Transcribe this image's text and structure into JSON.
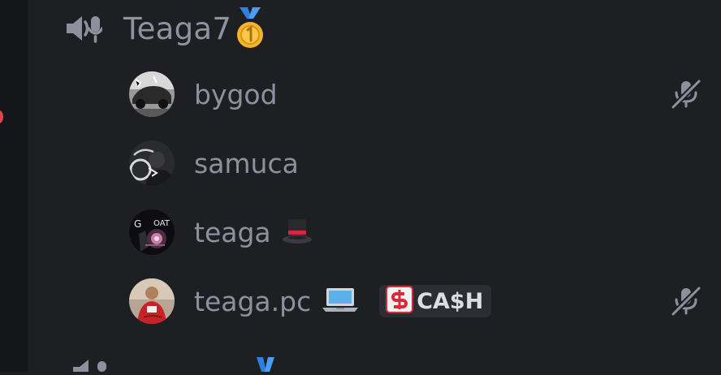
{
  "channel": {
    "name": "Teaga7",
    "emoji_icon": "first-place-medal"
  },
  "members": [
    {
      "username": "bygod",
      "avatar": "avatar-car-bw",
      "status_emoji": "",
      "tag": null,
      "muted": true
    },
    {
      "username": "samuca",
      "avatar": "avatar-dark-person",
      "status_emoji": "",
      "tag": null,
      "muted": false
    },
    {
      "username": "teaga",
      "avatar": "avatar-goat-art",
      "status_emoji": "top-hat",
      "tag": null,
      "muted": false
    },
    {
      "username": "teaga.pc",
      "avatar": "avatar-red-jacket",
      "status_emoji": "laptop",
      "tag": "CA$H",
      "muted": true
    }
  ],
  "colors": {
    "background": "#1e1f23",
    "server_bar": "#141518",
    "text_muted": "#8e919d",
    "tag_bg": "#2b2d33",
    "tag_text": "#dbdee4",
    "unread": "#e2434b"
  }
}
